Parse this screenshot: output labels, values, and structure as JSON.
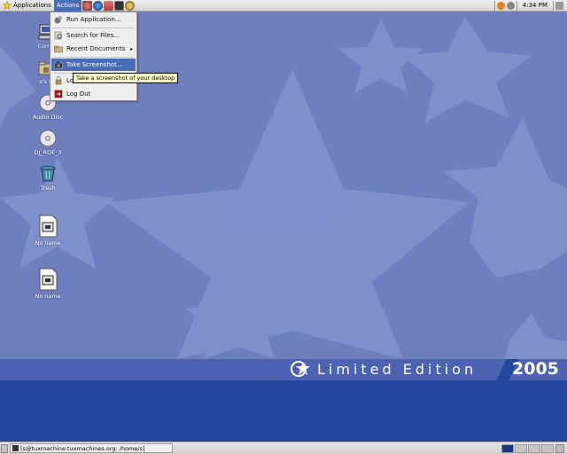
{
  "top_panel": {
    "applications_label": "Applications",
    "actions_label": "Actions",
    "launchers": [
      "gimp-icon",
      "browser-icon",
      "mail-icon",
      "terminal-icon",
      "network-icon"
    ],
    "clock": "4:34 PM"
  },
  "actions_menu": {
    "items": [
      {
        "label": "Run Application...",
        "icon": "run-icon"
      },
      {
        "label": "Search for Files...",
        "icon": "search-icon"
      },
      {
        "label": "Recent Documents",
        "icon": "folder-icon",
        "submenu": true
      },
      {
        "label": "Take Screenshot...",
        "icon": "camera-icon",
        "highlighted": true
      },
      {
        "label": "Lo",
        "icon": "lock-icon"
      },
      {
        "label": "Log Out",
        "icon": "logout-icon"
      }
    ],
    "submenu_arrow": "▸"
  },
  "tooltip": "Take a screenshot of your desktop",
  "desktop_icons": [
    {
      "label": "Comp",
      "icon": "computer-icon"
    },
    {
      "label": "s's H",
      "icon": "home-folder-icon"
    },
    {
      "label": "Audio Disc",
      "icon": "cd-icon"
    },
    {
      "label": "DJ_ROE_3",
      "icon": "cd-icon"
    },
    {
      "label": "Trash",
      "icon": "trash-icon"
    },
    {
      "label": "No name",
      "icon": "floppy-icon"
    },
    {
      "label": "No name",
      "icon": "floppy-icon"
    }
  ],
  "banner": {
    "edition_text": "Limited Edition",
    "year": "2005"
  },
  "bottom_panel": {
    "task_label": "[s@tuxmachine.tuxmachines.org: /home/s]",
    "workspaces": 4
  },
  "colors": {
    "desktop_bg": "#6e7fc0",
    "star_color": "#8a99cf",
    "banner_blue": "#2346a0",
    "menu_highlight": "#4a6cb6"
  }
}
